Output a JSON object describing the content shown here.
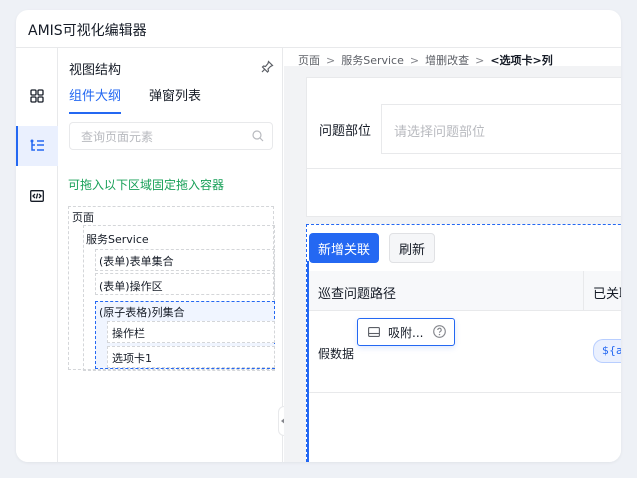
{
  "app": {
    "title": "AMIS可视化编辑器"
  },
  "rail": {
    "icons": [
      "grid-icon",
      "outline-tree-icon",
      "code-icon"
    ]
  },
  "panel": {
    "title": "视图结构",
    "tabs": [
      {
        "label": "组件大纲"
      },
      {
        "label": "弹窗列表"
      }
    ],
    "search_placeholder": "查询页面元素",
    "drop_hint": "可拖入以下区域固定拖入容器",
    "tree": {
      "page": "页面",
      "service": "服务Service",
      "form_set": "(表单)表单集合",
      "form_action": "(表单)操作区",
      "table_set": "(原子表格)列集合",
      "action_col": "操作栏",
      "tabs_col": "选项卡1"
    }
  },
  "breadcrumb": {
    "items": [
      "页面",
      "服务Service",
      "增删改查"
    ],
    "current": "<选项卡>列",
    "separator": ">"
  },
  "form": {
    "label": "问题部位",
    "placeholder": "请选择问题部位"
  },
  "crud": {
    "add_button": "新增关联",
    "refresh_button": "刷新",
    "columns": [
      "巡查问题路径",
      "已关联"
    ],
    "rows": [
      {
        "path": "假数据",
        "tag": "${ai"
      }
    ]
  },
  "popover": {
    "label": "吸附..."
  },
  "colors": {
    "primary": "#2468f2",
    "hint_green": "#18a058"
  }
}
